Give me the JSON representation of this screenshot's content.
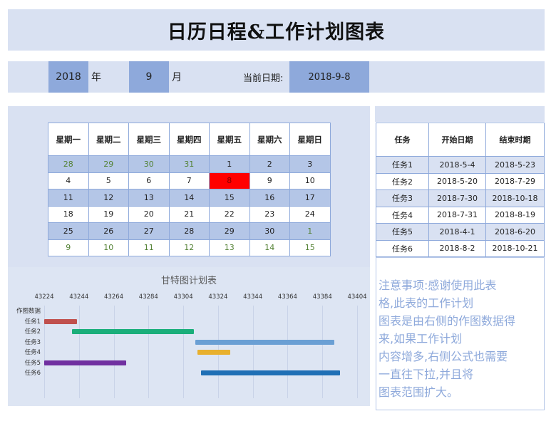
{
  "title": "日历日程&工作计划图表",
  "date_bar": {
    "year": "2018",
    "year_unit": "年",
    "month": "9",
    "month_unit": "月",
    "current_label": "当前日期:",
    "current_date": "2018-9-8"
  },
  "calendar": {
    "weekdays": [
      "星期一",
      "星期二",
      "星期三",
      "星期四",
      "星期五",
      "星期六",
      "星期日"
    ],
    "weeks": [
      [
        "28",
        "29",
        "30",
        "31",
        "1",
        "2",
        "3"
      ],
      [
        "4",
        "5",
        "6",
        "7",
        "8",
        "9",
        "10"
      ],
      [
        "11",
        "12",
        "13",
        "14",
        "15",
        "16",
        "17"
      ],
      [
        "18",
        "19",
        "20",
        "21",
        "22",
        "23",
        "24"
      ],
      [
        "25",
        "26",
        "27",
        "28",
        "29",
        "30",
        "1"
      ],
      [
        "9",
        "10",
        "11",
        "12",
        "13",
        "14",
        "15"
      ]
    ],
    "other_month_color": "#548235",
    "today_color": "#ff0000"
  },
  "tasks_table": {
    "headers": [
      "任务",
      "开始日期",
      "结束时期"
    ],
    "rows": [
      [
        "任务1",
        "2018-5-4",
        "2018-5-23"
      ],
      [
        "任务2",
        "2018-5-20",
        "2018-7-29"
      ],
      [
        "任务3",
        "2018-7-30",
        "2018-10-18"
      ],
      [
        "任务4",
        "2018-7-31",
        "2018-8-19"
      ],
      [
        "任务5",
        "2018-4-1",
        "2018-6-20"
      ],
      [
        "任务6",
        "2018-8-2",
        "2018-10-21"
      ]
    ]
  },
  "notes": {
    "lines": [
      "注意事项:感谢使用此表",
      "格,此表的工作计划",
      "图表是由右侧的作图数据得",
      "来,如果工作计划",
      "内容增多,右侧公式也需要",
      "一直往下拉,并且将",
      "图表范围扩大。"
    ]
  },
  "chart_data": {
    "type": "bar",
    "title": "甘特图计划表",
    "orientation": "horizontal-stacked-gantt",
    "x_ticks": [
      43224,
      43244,
      43264,
      43284,
      43304,
      43324,
      43344,
      43364,
      43384,
      43404
    ],
    "xlim": [
      43224,
      43404
    ],
    "categories": [
      "作图数据",
      "任务1",
      "任务2",
      "任务3",
      "任务4",
      "任务5",
      "任务6"
    ],
    "series": [
      {
        "name": "",
        "start": [
          null,
          43224,
          43240,
          43311,
          43312,
          43224,
          43314
        ],
        "end": [
          null,
          43243,
          43310,
          43391,
          43331,
          43271,
          43394
        ]
      }
    ],
    "colors": [
      "#c0504d",
      "#1aae7a",
      "#6a9fd4",
      "#e8b02e",
      "#7030a0",
      "#1f6fb5"
    ],
    "legend": "none",
    "grid": true
  }
}
